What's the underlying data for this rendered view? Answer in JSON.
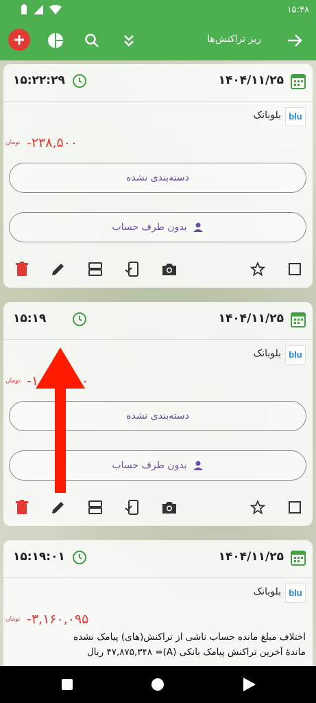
{
  "status": {
    "time": "۱۵:۴۸"
  },
  "appbar": {
    "title": "ریز تراکنش‌ها"
  },
  "cards": [
    {
      "date": "۱۴۰۴/۱۱/۲۵",
      "time": "۱۵:۲۲:۲۹",
      "bank_logo": "blu",
      "bank": "بلوبانک",
      "amount": "-۲۳۸,۵۰۰",
      "currency": "تومان",
      "category": "دسته‌بندی نشده",
      "account": "بدون طرف حساب"
    },
    {
      "date": "۱۴۰۴/۱۱/۲۵",
      "time": "۱۵:۱۹",
      "bank_logo": "blu",
      "bank": "بلوبانک",
      "amount": "-۱,۷۷۰,۰۰۰",
      "currency": "تومان",
      "category": "دسته‌بندی نشده",
      "account": "بدون طرف حساب"
    },
    {
      "date": "۱۴۰۴/۱۱/۲۵",
      "time": "۱۵:۱۹:۰۱",
      "bank_logo": "blu",
      "bank": "بلوبانک",
      "amount": "-۳,۱۶۰,۰۹۵",
      "currency": "تومان",
      "desc1": "اختلاف مبلغ مانده حساب ناشی از تراکنش(های) پیامک نشده",
      "desc2": "ماندهٔ آخرین تراکنش پیامک بانکی (A)= ۴۷,۸۷۵,۳۴۸ ریال"
    }
  ],
  "colors": {
    "accent": "#4caf50",
    "danger": "#e53935",
    "purple": "#6a4fa0",
    "annotation_arrow": "#ff1a00"
  }
}
